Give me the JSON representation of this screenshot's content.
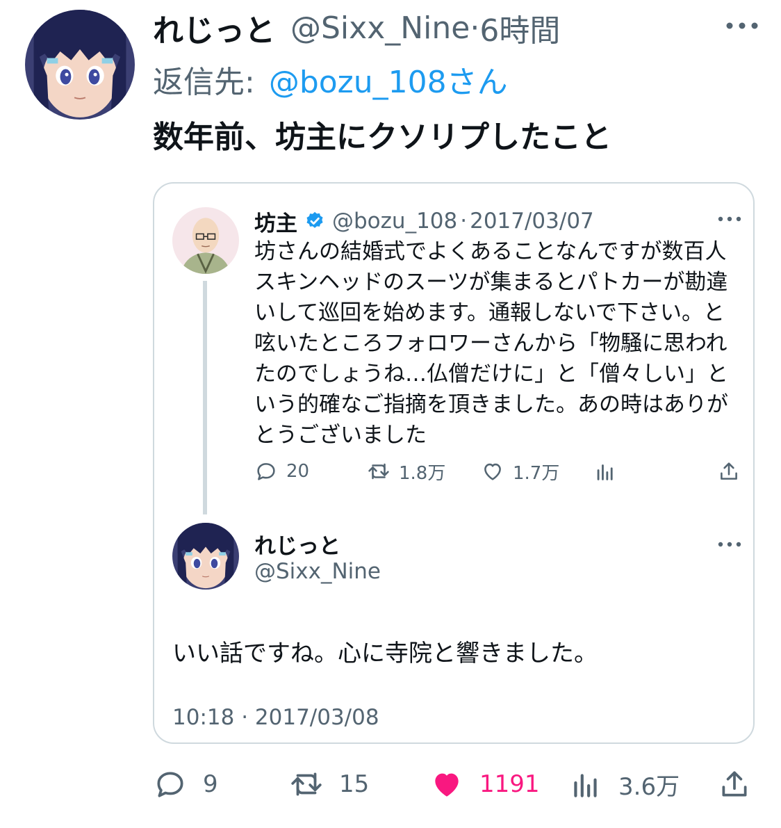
{
  "tweet": {
    "display_name": "れじっと",
    "handle": "@Sixx_Nine",
    "separator": "·",
    "time_ago": "6時間",
    "reply_label": "返信先:",
    "reply_target": "@bozu_108さん",
    "text": "数年前、坊主にクソリプしたこと"
  },
  "quoted": {
    "display_name": "坊主",
    "handle": "@bozu_108",
    "separator": "·",
    "date": "2017/03/07",
    "text": "坊さんの結婚式でよくあることなんですが数百人\nスキンヘッドのスーツが集まるとパトカーが勘違\nいして巡回を始めます。通報しないで下さい。と\n呟いたところフォロワーさんから「物騒に思われ\nたのでしょうね…仏僧だけに」と「僧々しい」と\nいう的確なご指摘を頂きました。あの時はありが\nとうございました",
    "actions": {
      "replies": "20",
      "retweets": "1.8万",
      "likes": "1.7万"
    }
  },
  "reply": {
    "display_name": "れじっと",
    "handle": "@Sixx_Nine",
    "text": "いい話ですね。心に寺院と響きました。",
    "timestamp": "10:18 · 2017/03/08"
  },
  "actions": {
    "replies": "9",
    "retweets": "15",
    "likes": "1191",
    "views": "3.6万"
  },
  "colors": {
    "text": "#0f1419",
    "secondary": "#536471",
    "link": "#1d9bf0",
    "like": "#f91880",
    "border": "#cfd9de"
  },
  "icons": [
    "avatar-anime",
    "avatar-monk",
    "verified-badge-icon",
    "more-icon",
    "reply-icon",
    "retweet-icon",
    "like-icon",
    "views-icon",
    "share-icon"
  ]
}
